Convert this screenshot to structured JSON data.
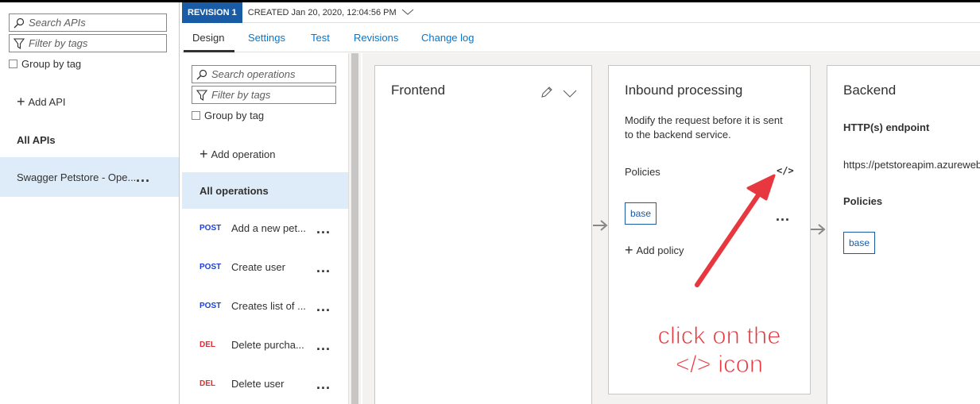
{
  "api_panel": {
    "search_placeholder": "Search APIs",
    "filter_placeholder": "Filter by tags",
    "group_by_tag": "Group by tag",
    "add_api": "Add API",
    "section": "All APIs",
    "selected_api": "Swagger Petstore - Ope...",
    "more": "..."
  },
  "revision": {
    "badge": "REVISION 1",
    "created": "CREATED Jan 20, 2020, 12:04:56 PM"
  },
  "tabs": [
    "Design",
    "Settings",
    "Test",
    "Revisions",
    "Change log"
  ],
  "ops_panel": {
    "search_placeholder": "Search operations",
    "filter_placeholder": "Filter by tags",
    "group_by_tag": "Group by tag",
    "add_operation": "Add operation",
    "all_operations": "All operations",
    "operations": [
      {
        "method": "POST",
        "name": "Add a new pet..."
      },
      {
        "method": "POST",
        "name": "Create user"
      },
      {
        "method": "POST",
        "name": "Creates list of ..."
      },
      {
        "method": "DEL",
        "name": "Delete purcha..."
      },
      {
        "method": "DEL",
        "name": "Delete user"
      }
    ],
    "more": "..."
  },
  "frontend": {
    "title": "Frontend"
  },
  "inbound": {
    "title": "Inbound processing",
    "description_line1": "Modify the request before it is sent",
    "description_line2": "to the backend service.",
    "policies": "Policies",
    "code_icon_label": "</>",
    "base": "base",
    "more": "...",
    "add_policy": "Add policy"
  },
  "backend": {
    "title": "Backend",
    "endpoint_label": "HTTP(s) endpoint",
    "endpoint_url": "https://petstoreapim.azureweb",
    "policies": "Policies",
    "base": "base"
  },
  "annotation": {
    "line1": "click on the",
    "line2": "</> icon",
    "color": "#e8383f"
  },
  "colors": {
    "accent": "#0078d4",
    "badge": "#1a5ba6",
    "selected": "#deecf9",
    "post": "#1e3fd2",
    "del": "#d13438"
  }
}
